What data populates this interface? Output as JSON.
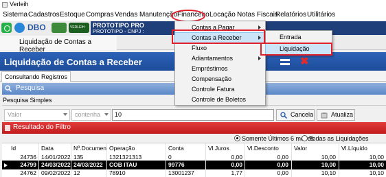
{
  "window": {
    "title": "Verleih"
  },
  "menubar": {
    "items": [
      "Sistema",
      "Cadastros",
      "Estoque",
      "Compras",
      "Vendas",
      "Manutenção",
      "Financeiro",
      "Locação",
      "Notas Fiscais",
      "Relatórios",
      "Utilitários"
    ]
  },
  "toolbar": {
    "icons": [
      "whatsapp-icon",
      "skype-icon",
      "dbo-logo",
      "flag-icon",
      "company-logo"
    ],
    "dbo_text": "DBO",
    "logo_text": "VERLEIH"
  },
  "company": {
    "name": "PROTOTIPO PRO",
    "cnpj": "PROTOTIPO - CNPJ :"
  },
  "tabs": {
    "active": "Liquidação de Contas a Receber"
  },
  "banner": {
    "title": "Liquidação de Contas a Receber"
  },
  "subtab": {
    "label": "Consultando Registros"
  },
  "pesquisa": {
    "header": "Pesquisa",
    "simples_label": "Pesquisa Simples",
    "field_combo": "Valor",
    "operator_combo": "contenha",
    "search_value": "10",
    "cancel_label": "Cancela",
    "update_label": "Atualiza"
  },
  "resultado": {
    "header": "Resultado do Filtro",
    "radio_last6": "Somente Últimos 6 meses",
    "radio_all": "Todas as Liquidações"
  },
  "grid": {
    "columns": [
      "Id",
      "Data",
      "Nº.Documento",
      "Operação",
      "Conta",
      "Vl.Juros",
      "Vl.Desconto",
      "Valor",
      "Vl.Líquido"
    ],
    "rows": [
      [
        "24736",
        "14/01/2022",
        "135",
        "1321321313",
        "0",
        "0,00",
        "0,00",
        "10,00",
        "10,00"
      ],
      [
        "24799",
        "24/03/2022",
        "24/03/2022",
        "COB ITAU",
        "99776",
        "0,00",
        "0,00",
        "10,00",
        "10,00"
      ],
      [
        "24762",
        "09/02/2022",
        "12",
        "78910",
        "13001237",
        "1,77",
        "0,00",
        "10,10",
        "10,10"
      ]
    ]
  },
  "financeiro_menu": {
    "items": [
      "Contas a Pagar",
      "Contas a Receber",
      "Fluxo",
      "Adiantamentos",
      "Empréstimos",
      "Compensação",
      "Controle Fatura",
      "Controle de Boletos"
    ]
  },
  "receber_submenu": {
    "items": [
      "Entrada",
      "Liquidação"
    ]
  }
}
